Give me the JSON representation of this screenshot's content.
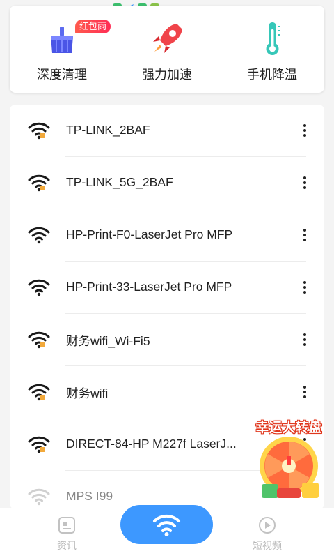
{
  "status_bar": {
    "icons": [
      "notification-icon",
      "location-icon",
      "app-icon",
      "app-icon"
    ]
  },
  "tools": {
    "items": [
      {
        "label": "深度清理",
        "icon": "broom-icon",
        "badge": "红包雨"
      },
      {
        "label": "强力加速",
        "icon": "rocket-icon"
      },
      {
        "label": "手机降温",
        "icon": "thermometer-icon"
      }
    ]
  },
  "wifi_list": {
    "networks": [
      {
        "ssid": "TP-LINK_2BAF",
        "locked": true
      },
      {
        "ssid": "TP-LINK_5G_2BAF",
        "locked": true
      },
      {
        "ssid": "HP-Print-F0-LaserJet Pro MFP",
        "locked": false
      },
      {
        "ssid": "HP-Print-33-LaserJet Pro MFP",
        "locked": false
      },
      {
        "ssid": "财务wifi_Wi-Fi5",
        "locked": true
      },
      {
        "ssid": "财务wifi",
        "locked": true
      },
      {
        "ssid": "DIRECT-84-HP M227f LaserJ...",
        "locked": true
      },
      {
        "ssid": "MPS I99",
        "locked": false
      }
    ]
  },
  "lucky_wheel": {
    "title": "幸运大转盘"
  },
  "tab_bar": {
    "tabs": [
      {
        "label": "资讯",
        "icon": "news-icon"
      },
      {
        "label": "",
        "icon": "wifi-icon"
      },
      {
        "label": "短视频",
        "icon": "video-play-icon"
      }
    ]
  },
  "colors": {
    "accent": "#3d98ff",
    "lock": "#f2a93b",
    "tab_inactive": "#b7b7b7"
  }
}
